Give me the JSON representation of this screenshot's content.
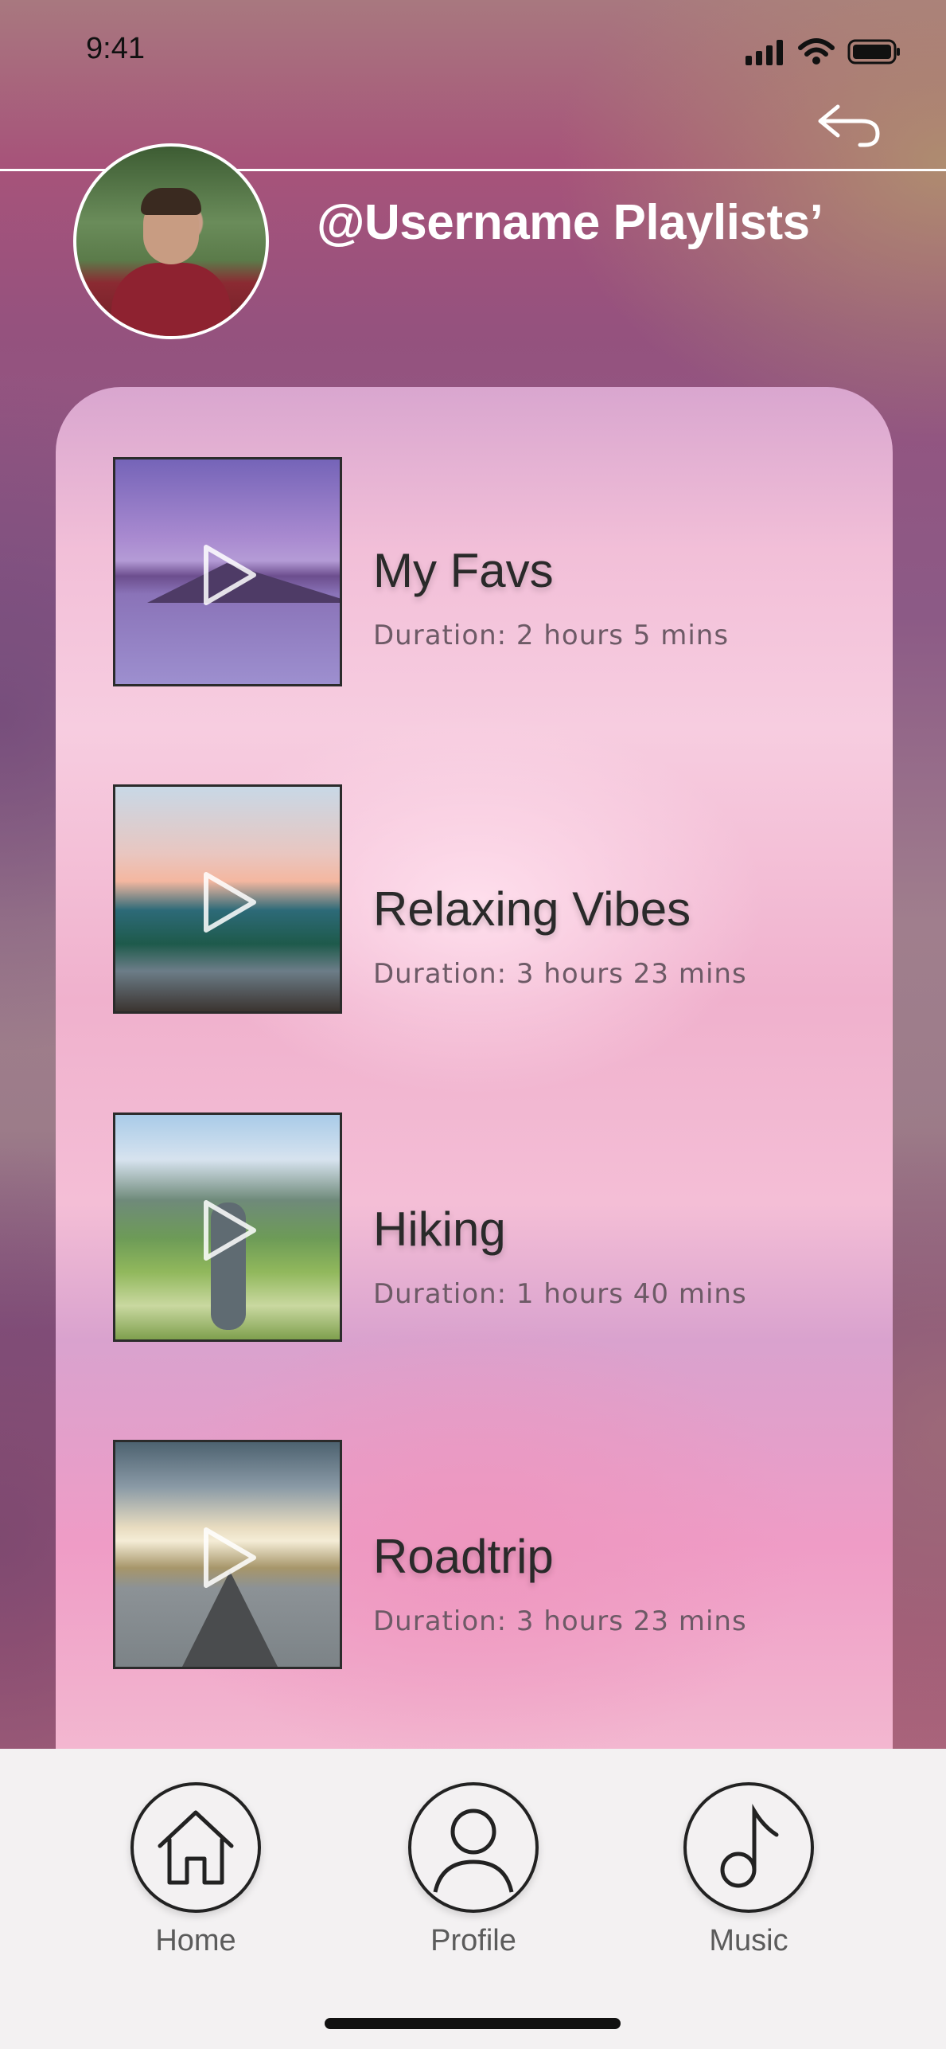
{
  "status_bar": {
    "time": "9:41",
    "icons": [
      "signal-icon",
      "wifi-icon",
      "battery-icon"
    ]
  },
  "header": {
    "title": "@Username Playlists’",
    "back_icon": "back-arrow-icon"
  },
  "playlists": [
    {
      "title": "My Favs",
      "duration": "Duration: 2 hours 5 mins"
    },
    {
      "title": "Relaxing Vibes",
      "duration": "Duration: 3 hours 23 mins"
    },
    {
      "title": "Hiking",
      "duration": "Duration: 1 hours 40 mins"
    },
    {
      "title": "Roadtrip",
      "duration": "Duration: 3 hours 23 mins"
    }
  ],
  "tabbar": {
    "items": [
      {
        "label": "Home",
        "icon": "home-icon"
      },
      {
        "label": "Profile",
        "icon": "profile-icon"
      },
      {
        "label": "Music",
        "icon": "music-note-icon"
      }
    ]
  }
}
